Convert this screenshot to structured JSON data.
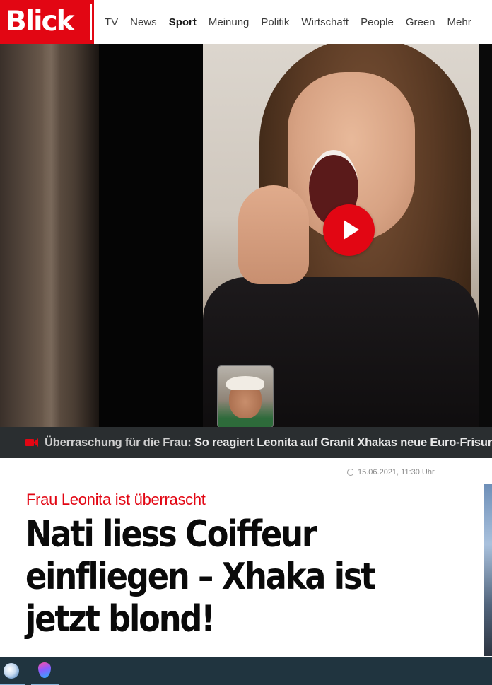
{
  "colors": {
    "brand": "#e20613",
    "caption_bg": "#2a2e30",
    "taskbar_bg": "#20343f"
  },
  "header": {
    "logo": "Blick",
    "nav": [
      "TV",
      "News",
      "Sport",
      "Meinung",
      "Politik",
      "Wirtschaft",
      "People",
      "Green",
      "Mehr"
    ],
    "active_nav": "Sport"
  },
  "video": {
    "play_icon": "play-icon",
    "caption_icon": "video-camera-icon",
    "caption_kicker": "Überraschung für die Frau:",
    "caption_title": " So reagiert Leonita auf Granit Xhakas neue Euro-Frisur"
  },
  "article": {
    "timestamp": "15.06.2021, 11:30 Uhr",
    "kicker": "Frau Leonita ist überrascht",
    "headline": "Nati liess Coiffeur einfliegen – Xhaka ist jetzt blond!"
  },
  "taskbar": {
    "apps": [
      "globe-app-icon",
      "drop-app-icon"
    ]
  }
}
